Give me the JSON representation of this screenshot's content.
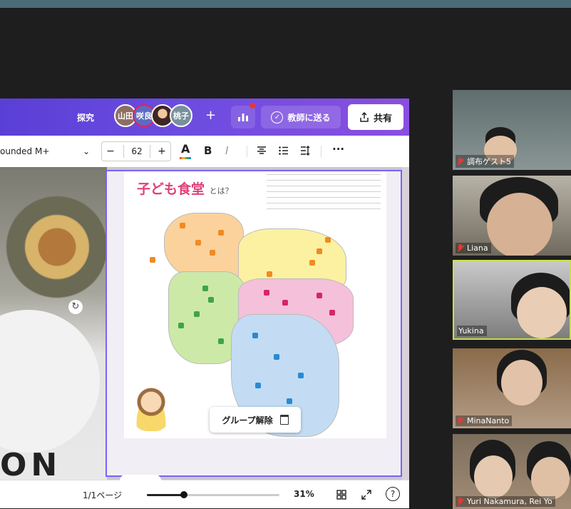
{
  "header": {
    "explore_label": "探究",
    "avatars": [
      "山田",
      "咲良",
      "",
      "桃子"
    ],
    "add_label": "+",
    "chart_icon": "bar-chart-icon",
    "send_label": "教師に送る",
    "share_label": "共有"
  },
  "toolbar": {
    "font_name": "ounded M+",
    "size_minus": "−",
    "font_size": "62",
    "size_plus": "+",
    "color_label": "A",
    "bold_label": "B",
    "italic_label": "I",
    "more_label": "···"
  },
  "canvas": {
    "poster_title": "子ども食堂",
    "poster_subtitle": "とは？",
    "ungroup_label": "グループ解除",
    "bg_text": "ON"
  },
  "statusbar": {
    "pages": "1/1ページ",
    "zoom_value": 0.31,
    "zoom": "31%",
    "help": "?"
  },
  "participants": [
    {
      "name": "調布ゲスト5",
      "muted": true
    },
    {
      "name": "Liana",
      "muted": true
    },
    {
      "name": "Yukina",
      "muted": false,
      "active": true
    },
    {
      "name": "MinaNanto",
      "muted": true
    },
    {
      "name": "Yuri Nakamura, Rei Yo",
      "muted": true
    }
  ],
  "colors": {
    "header_start": "#5a3fd6",
    "header_end": "#8a4fe0",
    "selection": "#7b61ff",
    "active_speaker": "#c7e04a",
    "muted": "#e53935"
  }
}
